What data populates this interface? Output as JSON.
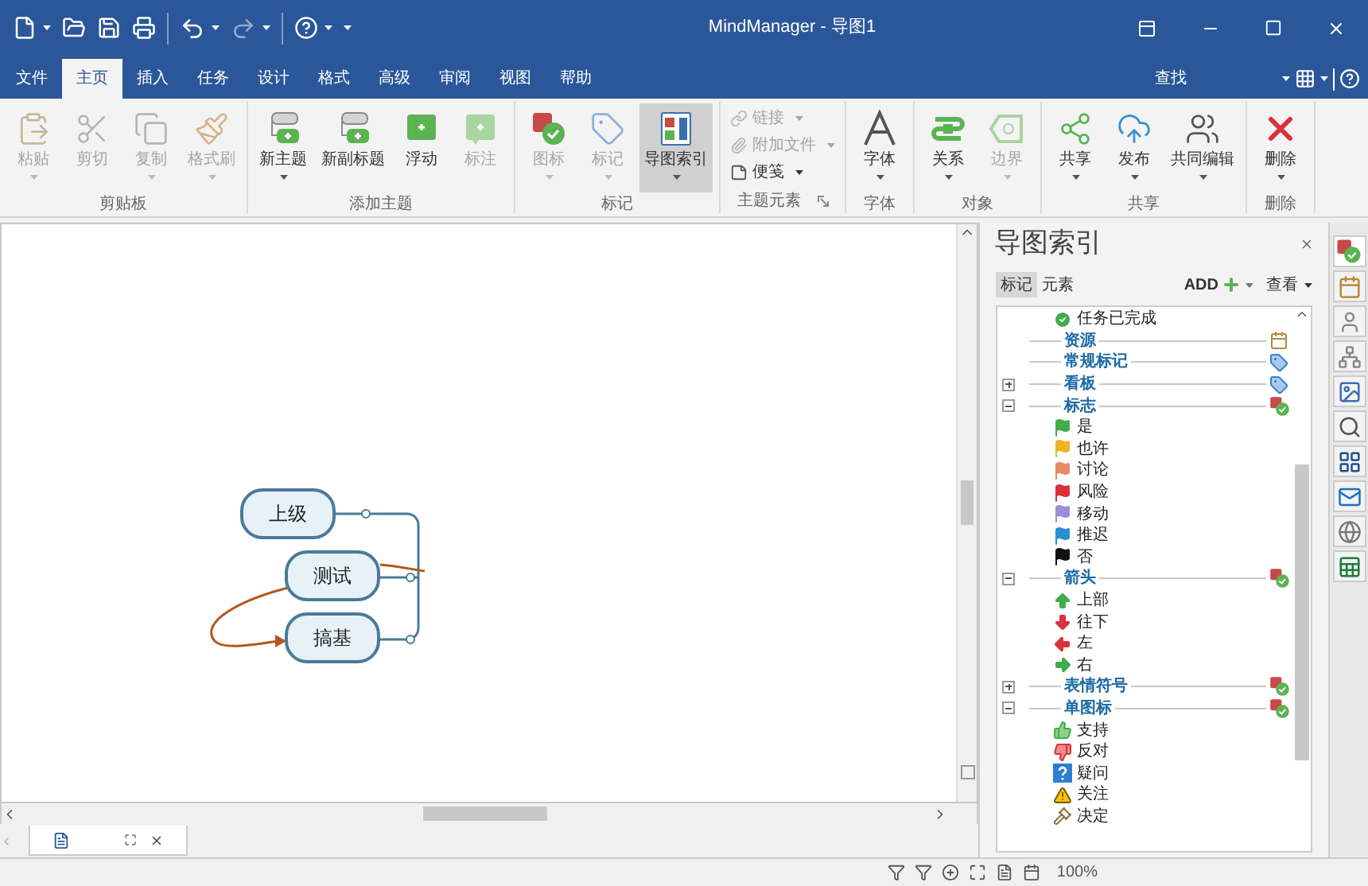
{
  "window": {
    "title": "MindManager - 导图1"
  },
  "menu_tabs": [
    {
      "label": "文件",
      "selected": false
    },
    {
      "label": "主页",
      "selected": true
    },
    {
      "label": "插入",
      "selected": false
    },
    {
      "label": "任务",
      "selected": false
    },
    {
      "label": "设计",
      "selected": false
    },
    {
      "label": "格式",
      "selected": false
    },
    {
      "label": "高级",
      "selected": false
    },
    {
      "label": "审阅",
      "selected": false
    },
    {
      "label": "视图",
      "selected": false
    },
    {
      "label": "帮助",
      "selected": false
    }
  ],
  "search_label": "查找",
  "ribbon": [
    {
      "label": "剪贴板",
      "kind": "large",
      "buttons": [
        {
          "label": "粘贴",
          "disabled": true,
          "dropdown": true
        },
        {
          "label": "剪切",
          "disabled": true,
          "dropdown": false
        },
        {
          "label": "复制",
          "disabled": true,
          "dropdown": true
        },
        {
          "label": "格式刷",
          "disabled": true,
          "dropdown": true
        }
      ]
    },
    {
      "label": "添加主题",
      "kind": "large",
      "buttons": [
        {
          "label": "新主题",
          "disabled": false,
          "dropdown": true
        },
        {
          "label": "新副标题",
          "disabled": false,
          "dropdown": false
        },
        {
          "label": "浮动",
          "disabled": false,
          "dropdown": false
        },
        {
          "label": "标注",
          "disabled": true,
          "dropdown": false
        }
      ]
    },
    {
      "label": "标记",
      "kind": "large",
      "buttons": [
        {
          "label": "图标",
          "disabled": true,
          "dropdown": true,
          "on": false
        },
        {
          "label": "标记",
          "disabled": true,
          "dropdown": true,
          "on": false
        },
        {
          "label": "导图索引",
          "disabled": false,
          "dropdown": true,
          "on": true
        }
      ]
    },
    {
      "label": "主题元素",
      "kind": "small",
      "buttons": [
        {
          "label": "链接",
          "disabled": true,
          "dropdown": true
        },
        {
          "label": "附加文件",
          "disabled": true,
          "dropdown": true
        },
        {
          "label": "便笺",
          "disabled": false,
          "dropdown": true
        }
      ]
    },
    {
      "label": "字体",
      "kind": "large",
      "buttons": [
        {
          "label": "字体",
          "disabled": false,
          "dropdown": true
        }
      ]
    },
    {
      "label": "对象",
      "kind": "large",
      "buttons": [
        {
          "label": "关系",
          "disabled": false,
          "dropdown": true
        },
        {
          "label": "边界",
          "disabled": true,
          "dropdown": true
        }
      ]
    },
    {
      "label": "共享",
      "kind": "large",
      "buttons": [
        {
          "label": "共享",
          "disabled": false,
          "dropdown": true
        },
        {
          "label": "发布",
          "disabled": false,
          "dropdown": true
        },
        {
          "label": "共同编辑",
          "disabled": false,
          "dropdown": true
        }
      ]
    },
    {
      "label": "删除",
      "kind": "large",
      "buttons": [
        {
          "label": "删除",
          "disabled": false,
          "dropdown": true
        }
      ]
    }
  ],
  "canvas": {
    "topics": [
      {
        "label": "上级"
      },
      {
        "label": "测试"
      },
      {
        "label": "搞基"
      }
    ]
  },
  "map_index": {
    "title": "导图索引",
    "tabs": [
      {
        "label": "标记",
        "selected": true
      },
      {
        "label": "元素",
        "selected": false
      }
    ],
    "add": "ADD",
    "view": "查看",
    "tree": [
      {
        "kind": "check",
        "label": "任务已完成"
      },
      {
        "kind": "category",
        "label": "资源"
      },
      {
        "kind": "category",
        "label": "常规标记"
      },
      {
        "kind": "category",
        "label": "看板",
        "expanded": false
      },
      {
        "kind": "category",
        "label": "标志",
        "expanded": true,
        "children": [
          {
            "kind": "flag",
            "label": "是",
            "color": "#3fae49"
          },
          {
            "kind": "flag",
            "label": "也许",
            "color": "#f0b323"
          },
          {
            "kind": "flag",
            "label": "讨论",
            "color": "#e8896a"
          },
          {
            "kind": "flag",
            "label": "风险",
            "color": "#d9323b"
          },
          {
            "kind": "flag",
            "label": "移动",
            "color": "#9a8fd6"
          },
          {
            "kind": "flag",
            "label": "推迟",
            "color": "#2a8fd0"
          },
          {
            "kind": "flag",
            "label": "否",
            "color": "#111111"
          }
        ]
      },
      {
        "kind": "category",
        "label": "箭头",
        "expanded": true,
        "children": [
          {
            "kind": "up",
            "label": "上部",
            "color": "#3fae49"
          },
          {
            "kind": "down",
            "label": "往下",
            "color": "#d9323b"
          },
          {
            "kind": "left",
            "label": "左",
            "color": "#d9323b"
          },
          {
            "kind": "right",
            "label": "右",
            "color": "#3fae49"
          }
        ]
      },
      {
        "kind": "category",
        "label": "表情符号",
        "expanded": false
      },
      {
        "kind": "category",
        "label": "单图标",
        "expanded": true,
        "children": [
          {
            "kind": "thumbsup",
            "label": "支持"
          },
          {
            "kind": "thumbsdown",
            "label": "反对"
          },
          {
            "kind": "question",
            "label": "疑问"
          },
          {
            "kind": "warning",
            "label": "关注"
          },
          {
            "kind": "gavel",
            "label": "决定"
          }
        ]
      }
    ]
  },
  "status_bar": {
    "zoom": "100%"
  }
}
